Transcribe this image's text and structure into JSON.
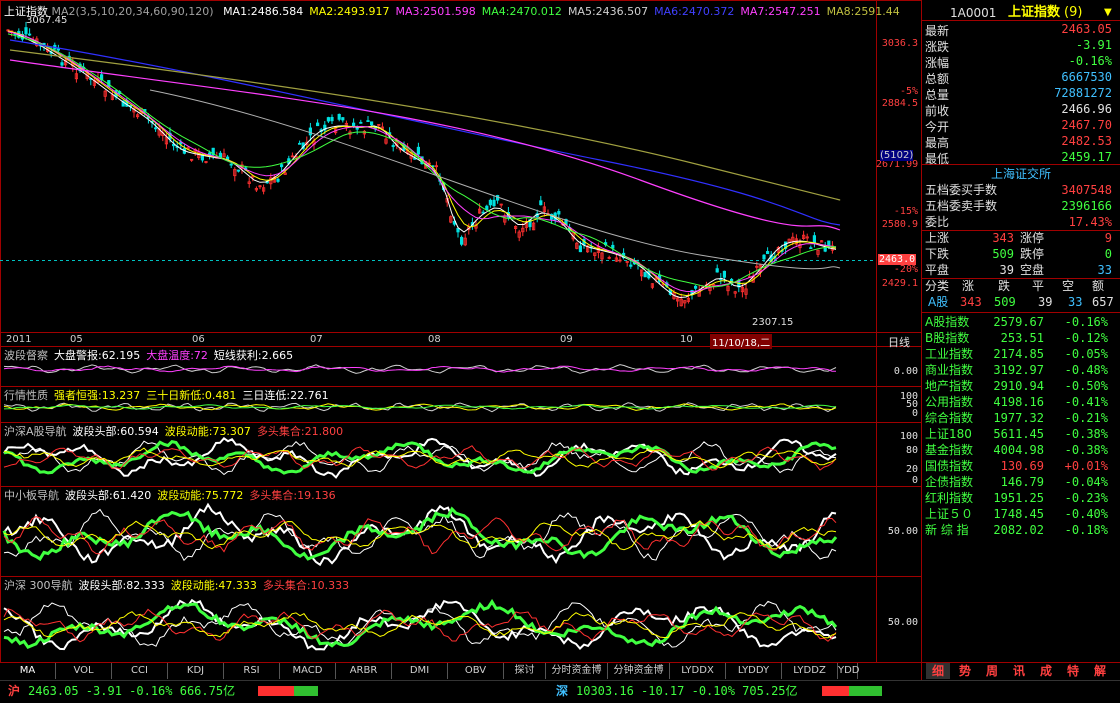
{
  "main_chart": {
    "title": "上证指数",
    "ma_params": "MA2(3,5,10,20,34,60,90,120)",
    "ma_values": [
      {
        "label": "MA1:2486.584",
        "color": "#ffffff"
      },
      {
        "label": "MA2:2493.917",
        "color": "#ffff00"
      },
      {
        "label": "MA3:2501.598",
        "color": "#ff40ff"
      },
      {
        "label": "MA4:2470.012",
        "color": "#40ff40"
      },
      {
        "label": "MA5:2436.507",
        "color": "#d0d0d0"
      },
      {
        "label": "MA6:2470.372",
        "color": "#4040ff"
      },
      {
        "label": "MA7:2547.251",
        "color": "#ff40ff"
      },
      {
        "label": "MA8:2591.44",
        "color": "#c0c040"
      }
    ],
    "high_mark": "3067.45",
    "low_mark": "2307.15",
    "date_marker": "11/10/18,二",
    "current_price_tag": "2463.0",
    "scale_tag": "(5102)",
    "y_labels": [
      {
        "text": "3036.3",
        "c": "#ff4040"
      },
      {
        "text": "-5%",
        "c": "#ff4040"
      },
      {
        "text": "2884.5",
        "c": "#ff4040"
      },
      {
        "text": "2671.99",
        "c": "#ff4040"
      },
      {
        "text": "-15%",
        "c": "#ff4040"
      },
      {
        "text": "2580.9",
        "c": "#ff4040"
      },
      {
        "text": "-20%",
        "c": "#ff4040"
      },
      {
        "text": "2429.1",
        "c": "#ff4040"
      }
    ],
    "x_labels": [
      "2011",
      "05",
      "06",
      "07",
      "08",
      "09",
      "10"
    ],
    "period": "日线"
  },
  "sub_panels": [
    {
      "name": "波段督察",
      "items": [
        {
          "t": "大盘警报:62.195",
          "c": "#ffffff"
        },
        {
          "t": "大盘温度:72",
          "c": "#ff40ff"
        },
        {
          "t": "短线获利:2.665",
          "c": "#ffffff"
        }
      ],
      "right": [
        "0.00"
      ]
    },
    {
      "name": "行情性质",
      "items": [
        {
          "t": "强者恒强:13.237",
          "c": "#ffff00"
        },
        {
          "t": "三十日新低:0.481",
          "c": "#ffff00"
        },
        {
          "t": "三日连低:22.761",
          "c": "#ffffff"
        }
      ],
      "right": [
        "100",
        "50",
        "0"
      ]
    },
    {
      "name": "沪深A股导航",
      "items": [
        {
          "t": "波段头部:60.594",
          "c": "#ffffff"
        },
        {
          "t": "波段动能:73.307",
          "c": "#ffff00"
        },
        {
          "t": "多头集合:21.800",
          "c": "#ff4040"
        }
      ],
      "right": [
        "100",
        "80",
        "20",
        "0"
      ]
    },
    {
      "name": "中小板导航",
      "items": [
        {
          "t": "波段头部:61.420",
          "c": "#ffffff"
        },
        {
          "t": "波段动能:75.772",
          "c": "#ffff00"
        },
        {
          "t": "多头集合:19.136",
          "c": "#ff4040"
        }
      ],
      "right": [
        "50.00"
      ]
    },
    {
      "name": "沪深 300导航",
      "items": [
        {
          "t": "波段头部:82.333",
          "c": "#ffffff"
        },
        {
          "t": "波段动能:47.333",
          "c": "#ffff00"
        },
        {
          "t": "多头集合:10.333",
          "c": "#ff4040"
        }
      ],
      "right": [
        "50.00"
      ]
    }
  ],
  "tabs": [
    "MA",
    "VOL",
    "CCI",
    "KDJ",
    "RSI",
    "MACD",
    "ARBR",
    "DMI",
    "OBV",
    "探讨",
    "分时资金博",
    "分钟资金博",
    "LYDDX",
    "LYDDY",
    "LYDDZ",
    "YDD"
  ],
  "right_panel": {
    "code": "1A0001",
    "name": "上证指数",
    "name_suffix": "(9)",
    "quote": [
      {
        "l": "最新",
        "v": "2463.05",
        "c": "#ff4040"
      },
      {
        "l": "涨跌",
        "v": "-3.91",
        "c": "#40ff40"
      },
      {
        "l": "涨幅",
        "v": "-0.16%",
        "c": "#40ff40"
      },
      {
        "l": "总额",
        "v": "6667530",
        "c": "#40c0ff"
      },
      {
        "l": "总量",
        "v": "72881272",
        "c": "#40c0ff"
      },
      {
        "l": "前收",
        "v": "2466.96",
        "c": "#e0e0e0"
      },
      {
        "l": "今开",
        "v": "2467.70",
        "c": "#ff4040"
      },
      {
        "l": "最高",
        "v": "2482.53",
        "c": "#ff4040"
      },
      {
        "l": "最低",
        "v": "2459.17",
        "c": "#40ff40"
      }
    ],
    "exchange": "上海证交所",
    "exch_rows": [
      {
        "l": "五档委买手数",
        "v": "3407548",
        "c": "#ff4040"
      },
      {
        "l": "五档委卖手数",
        "v": "2396166",
        "c": "#40ff40"
      },
      {
        "l": "委比",
        "v": "17.43%",
        "c": "#ff4040"
      }
    ],
    "updown": [
      {
        "l1": "上涨",
        "v1": "343",
        "c1": "#ff4040",
        "l2": "涨停",
        "v2": "9",
        "c2": "#ff4040"
      },
      {
        "l1": "下跌",
        "v1": "509",
        "c1": "#40ff40",
        "l2": "跌停",
        "v2": "0",
        "c2": "#40ff40"
      },
      {
        "l1": "平盘",
        "v1": "39",
        "c1": "#e0e0e0",
        "l2": "空盘",
        "v2": "33",
        "c2": "#40c0ff"
      }
    ],
    "class_header": [
      "分类",
      "涨",
      "跌",
      "平",
      "空",
      "额"
    ],
    "class_row": {
      "l": "A股",
      "vals": [
        {
          "t": "343",
          "c": "#ff4040"
        },
        {
          "t": "509",
          "c": "#40ff40"
        },
        {
          "t": "39",
          "c": "#e0e0e0"
        },
        {
          "t": "33",
          "c": "#40c0ff"
        },
        {
          "t": "657",
          "c": "#e0e0e0"
        }
      ]
    },
    "indices": [
      {
        "n": "A股指数",
        "v": "2579.67",
        "p": "-0.16%",
        "c": "#40ff40"
      },
      {
        "n": "B股指数",
        "v": "253.51",
        "p": "-0.12%",
        "c": "#40ff40"
      },
      {
        "n": "工业指数",
        "v": "2174.85",
        "p": "-0.05%",
        "c": "#40ff40"
      },
      {
        "n": "商业指数",
        "v": "3192.97",
        "p": "-0.48%",
        "c": "#40ff40"
      },
      {
        "n": "地产指数",
        "v": "2910.94",
        "p": "-0.50%",
        "c": "#40ff40"
      },
      {
        "n": "公用指数",
        "v": "4198.16",
        "p": "-0.41%",
        "c": "#40ff40"
      },
      {
        "n": "综合指数",
        "v": "1977.32",
        "p": "-0.21%",
        "c": "#40ff40"
      },
      {
        "n": "上证180",
        "v": "5611.45",
        "p": "-0.38%",
        "c": "#40ff40"
      },
      {
        "n": "基金指数",
        "v": "4004.98",
        "p": "-0.38%",
        "c": "#40ff40"
      },
      {
        "n": "国债指数",
        "v": "130.69",
        "p": "+0.01%",
        "c": "#ff4040"
      },
      {
        "n": "企债指数",
        "v": "146.79",
        "p": "-0.04%",
        "c": "#40ff40"
      },
      {
        "n": "红利指数",
        "v": "1951.25",
        "p": "-0.23%",
        "c": "#40ff40"
      },
      {
        "n": "上证５０",
        "v": "1748.45",
        "p": "-0.40%",
        "c": "#40ff40"
      },
      {
        "n": "新 综 指",
        "v": "2082.02",
        "p": "-0.18%",
        "c": "#40ff40"
      }
    ],
    "bottom_tabs": [
      "细",
      "势",
      "周",
      "讯",
      "成",
      "特",
      "解"
    ]
  },
  "status_bar": {
    "sh_label": "沪",
    "sh_text": "2463.05 -3.91 -0.16% 666.75亿",
    "sz_label": "深",
    "sz_text": "10303.16 -10.17 -0.10% 705.25亿"
  }
}
